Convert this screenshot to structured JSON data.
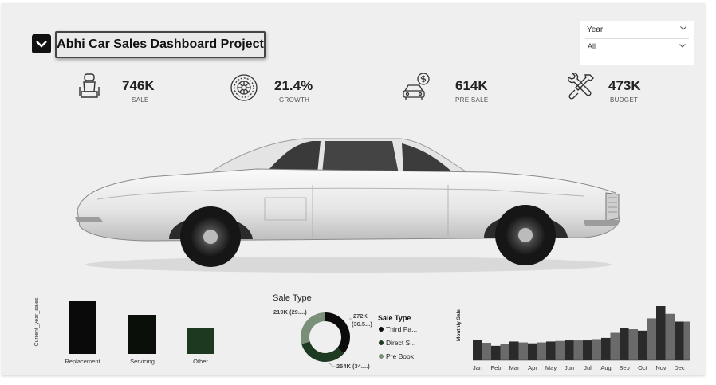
{
  "header": {
    "title": "Abhi Car Sales Dashboard Project"
  },
  "slicer": {
    "label": "Year",
    "selected": "All"
  },
  "kpis": [
    {
      "value": "746K",
      "caption": "SALE",
      "icon": "car-seat-icon"
    },
    {
      "value": "21.4%",
      "caption": "GROWTH",
      "icon": "tire-icon"
    },
    {
      "value": "614K",
      "caption": "PRE SALE",
      "icon": "car-dollar-icon"
    },
    {
      "value": "473K",
      "caption": "BUDGET",
      "icon": "wrench-screwdriver-icon"
    }
  ],
  "colors": {
    "dark": "#0b0b0b",
    "mid_green": "#1f3a22",
    "sage": "#7a8f78",
    "gray_bar": "#555555"
  },
  "chart_data": [
    {
      "type": "bar",
      "categories": [
        "Replacement",
        "Servicing",
        "Other"
      ],
      "values": [
        66,
        49,
        32
      ],
      "ylabel": "Current_year_sales",
      "colors": [
        "#0a0a0a",
        "#0a0f0a",
        "#1d3a20"
      ]
    },
    {
      "type": "pie",
      "title": "Sale Type",
      "legend_title": "Sale Type",
      "labels": [
        "Third Pa...",
        "Direct S...",
        "Pre Book"
      ],
      "slice_labels": [
        "272K (36.5...)",
        "254K (34....)",
        "219K (29....)"
      ],
      "values": [
        272,
        254,
        219
      ],
      "colors": [
        "#0b0b0b",
        "#1f3a22",
        "#7a8f78"
      ]
    },
    {
      "type": "bar",
      "ylabel": "Monthly Sale",
      "categories": [
        "Jan",
        "Feb",
        "Mar",
        "Apr",
        "May",
        "Jun",
        "Jul",
        "Aug",
        "Sep",
        "Oct",
        "Nov",
        "Dec"
      ],
      "values": [
        57,
        40,
        52,
        47,
        52,
        55,
        55,
        62,
        90,
        82,
        150,
        107
      ]
    }
  ]
}
